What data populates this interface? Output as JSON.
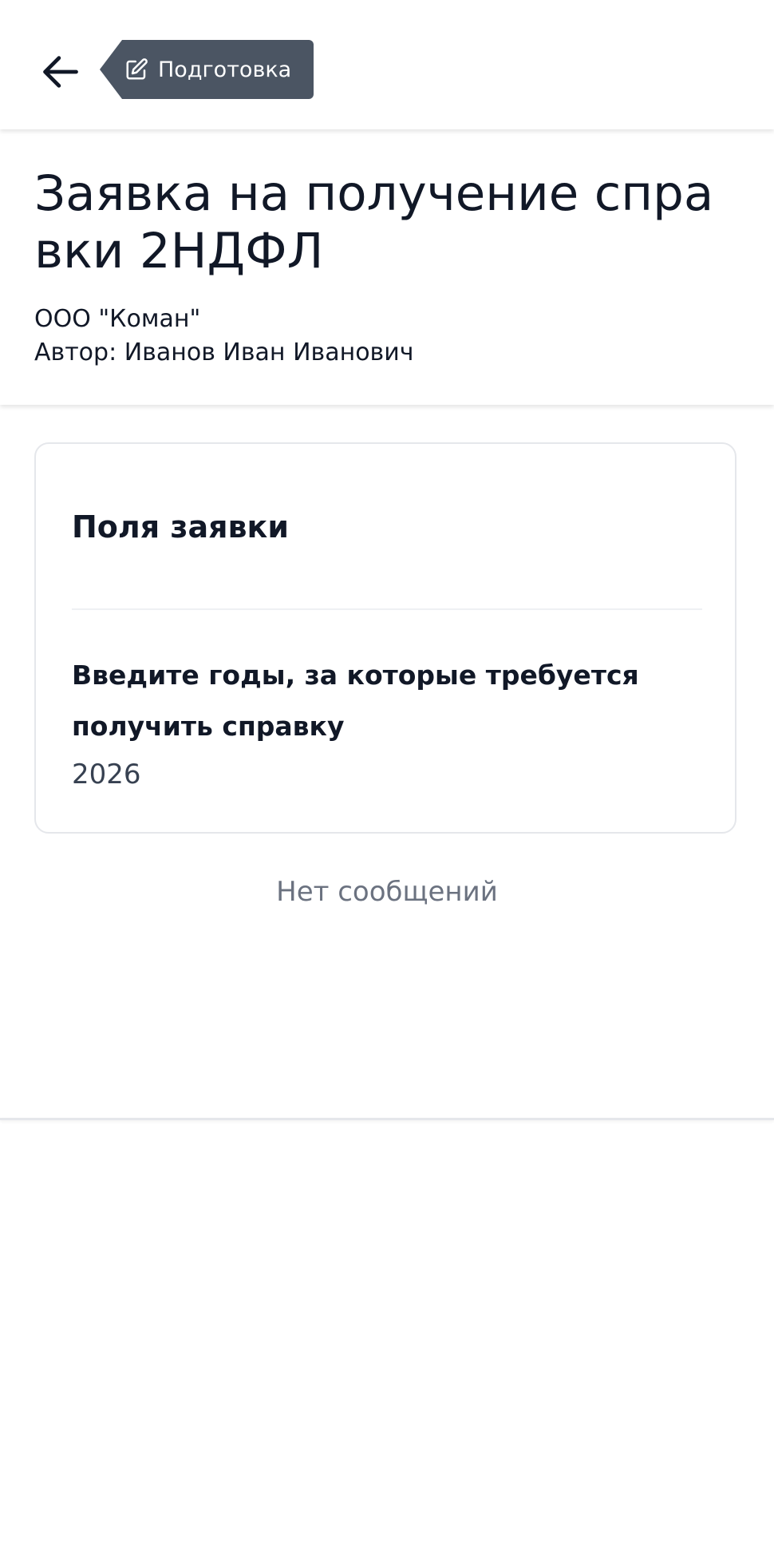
{
  "header": {
    "back_icon": "arrow-left-icon",
    "status": {
      "icon": "edit-icon",
      "label": "Подготовка",
      "color": "#4b5563"
    }
  },
  "request": {
    "title": "Заявка на получение справки 2НДФЛ",
    "organization": "ООО \"Коман\"",
    "author": "Автор: Иванов Иван Иванович"
  },
  "fields_card": {
    "title": "Поля заявки",
    "fields": [
      {
        "label": "Введите годы, за которые требуется получить справку",
        "value": "2026"
      }
    ]
  },
  "messages": {
    "empty_text": "Нет сообщений"
  }
}
